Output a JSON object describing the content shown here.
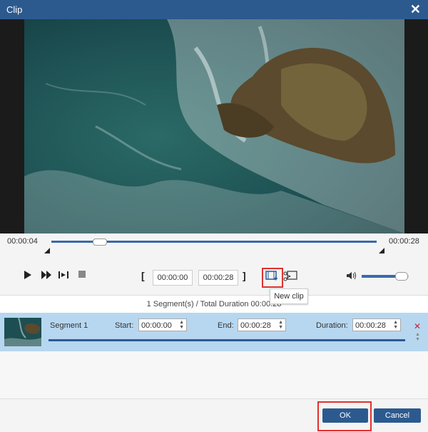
{
  "window": {
    "title": "Clip"
  },
  "timeline": {
    "current_time": "00:00:04",
    "total_time": "00:00:28"
  },
  "controls": {
    "start_time": "00:00:00",
    "end_time": "00:00:28",
    "volume_level": 0.85
  },
  "tooltip": {
    "text": "New clip"
  },
  "summary": "1 Segment(s) / Total Duration 00:00:28",
  "segment": {
    "name": "Segment 1",
    "start_label": "Start:",
    "start_value": "00:00:00",
    "end_label": "End:",
    "end_value": "00:00:28",
    "duration_label": "Duration:",
    "duration_value": "00:00:28"
  },
  "footer": {
    "ok_label": "OK",
    "cancel_label": "Cancel"
  },
  "colors": {
    "titlebar": "#2c5a8f",
    "accent": "#3a6aa8",
    "segment_bg": "#b7d7f0",
    "highlight": "#e0322f"
  }
}
